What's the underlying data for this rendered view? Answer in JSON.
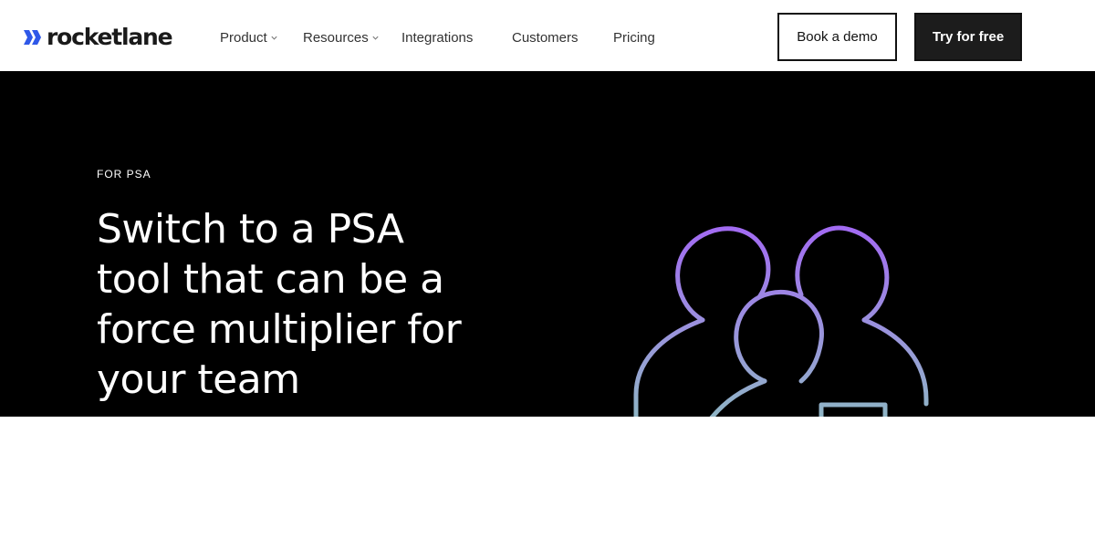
{
  "header": {
    "logo_text": "rocketlane",
    "logo_icon": "double-chevron-right-icon",
    "nav": [
      {
        "label": "Product",
        "has_dropdown": true
      },
      {
        "label": "Resources",
        "has_dropdown": true
      },
      {
        "label": "Integrations",
        "has_dropdown": false
      },
      {
        "label": "Customers",
        "has_dropdown": false
      },
      {
        "label": "Pricing",
        "has_dropdown": false
      }
    ],
    "book_demo_label": "Book a demo",
    "try_free_label": "Try for free"
  },
  "hero": {
    "eyebrow": "FOR PSA",
    "headline": "Switch to a PSA tool that can be a force multiplier for your team",
    "illustration": "team-people-icon"
  },
  "colors": {
    "brand_blue": "#2f58e8",
    "hero_bg": "#000000",
    "gradient_top": "#9b6bf0",
    "gradient_bottom": "#8fb3c7"
  }
}
